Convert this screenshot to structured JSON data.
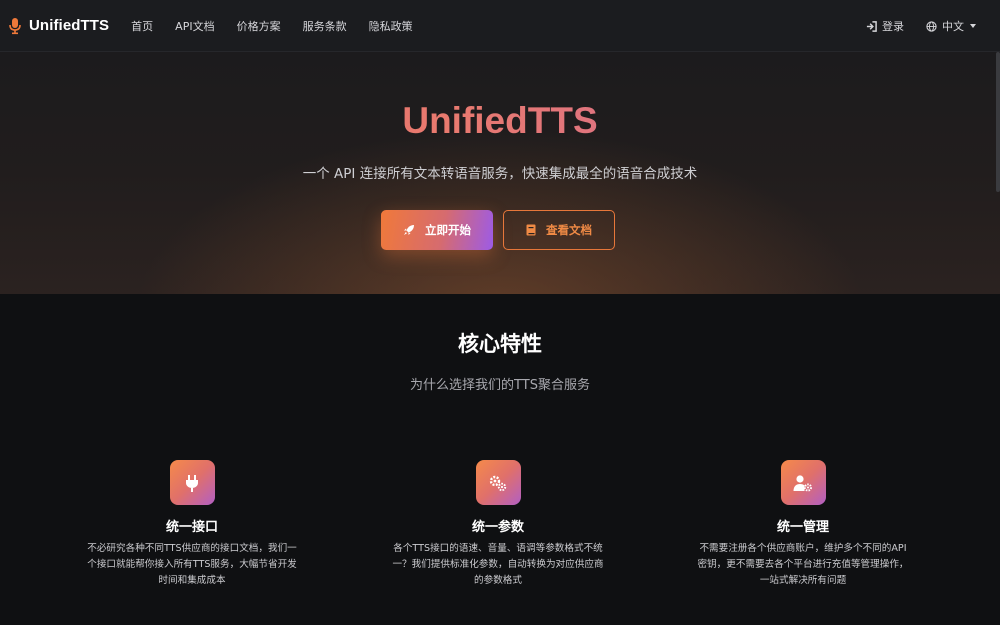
{
  "nav": {
    "brand": "UnifiedTTS",
    "links": [
      "首页",
      "API文档",
      "价格方案",
      "服务条款",
      "隐私政策"
    ],
    "login": "登录",
    "language": "中文"
  },
  "hero": {
    "title": "UnifiedTTS",
    "subtitle": "一个 API 连接所有文本转语音服务，快速集成最全的语音合成技术",
    "primary_button": "立即开始",
    "secondary_button": "查看文档"
  },
  "features_section": {
    "title": "核心特性",
    "subtitle": "为什么选择我们的TTS聚合服务",
    "items": [
      {
        "icon": "plug-icon",
        "title": "统一接口",
        "desc": "不必研究各种不同TTS供应商的接口文档，我们一个接口就能帮你接入所有TTS服务，大幅节省开发时间和集成成本"
      },
      {
        "icon": "gears-icon",
        "title": "统一参数",
        "desc": "各个TTS接口的语速、音量、语调等参数格式不统一？我们提供标准化参数，自动转换为对应供应商的参数格式"
      },
      {
        "icon": "user-gear-icon",
        "title": "统一管理",
        "desc": "不需要注册各个供应商账户，维护多个不同的API密钥，更不需要去各个平台进行充值等管理操作，一站式解决所有问题"
      }
    ]
  },
  "colors": {
    "accent_orange": "#f0793a",
    "accent_purple": "#9d5be6",
    "background": "#0f1012",
    "navbar": "#1b1c1f"
  }
}
